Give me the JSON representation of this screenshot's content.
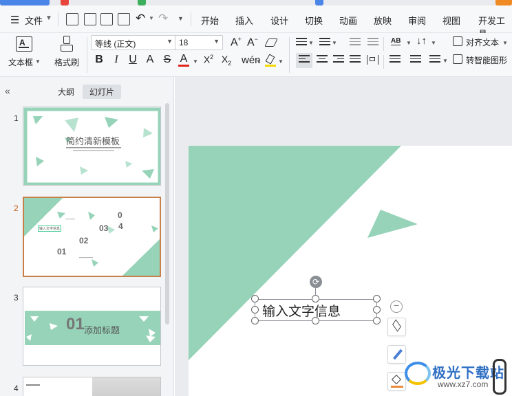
{
  "menu": {
    "file": "文件",
    "tabs": [
      "开始",
      "插入",
      "设计",
      "切换",
      "动画",
      "放映",
      "审阅",
      "视图",
      "开发工具"
    ]
  },
  "ribbon": {
    "textbox": "文本框",
    "format_painter": "格式刷",
    "font_name": "等线 (正文)",
    "font_size": "18",
    "align_text": "对齐文本",
    "smartart": "转智能图形"
  },
  "panel": {
    "tab_outline": "大纲",
    "tab_slides": "幻灯片",
    "slides": [
      {
        "num": "1",
        "title": "简约清新模板"
      },
      {
        "num": "2",
        "items": [
          "输入文字信息",
          "0",
          "4",
          "03",
          "02",
          "01"
        ]
      },
      {
        "num": "3",
        "number": "01",
        "title": "添加标题"
      },
      {
        "num": "4"
      }
    ]
  },
  "editor": {
    "textbox_text": "输入文字信息"
  },
  "watermark": {
    "name": "极光下载站",
    "url": "www.xz7.com"
  },
  "colors": {
    "accent_green": "#96d3b9",
    "selection_orange": "#c8804a"
  }
}
